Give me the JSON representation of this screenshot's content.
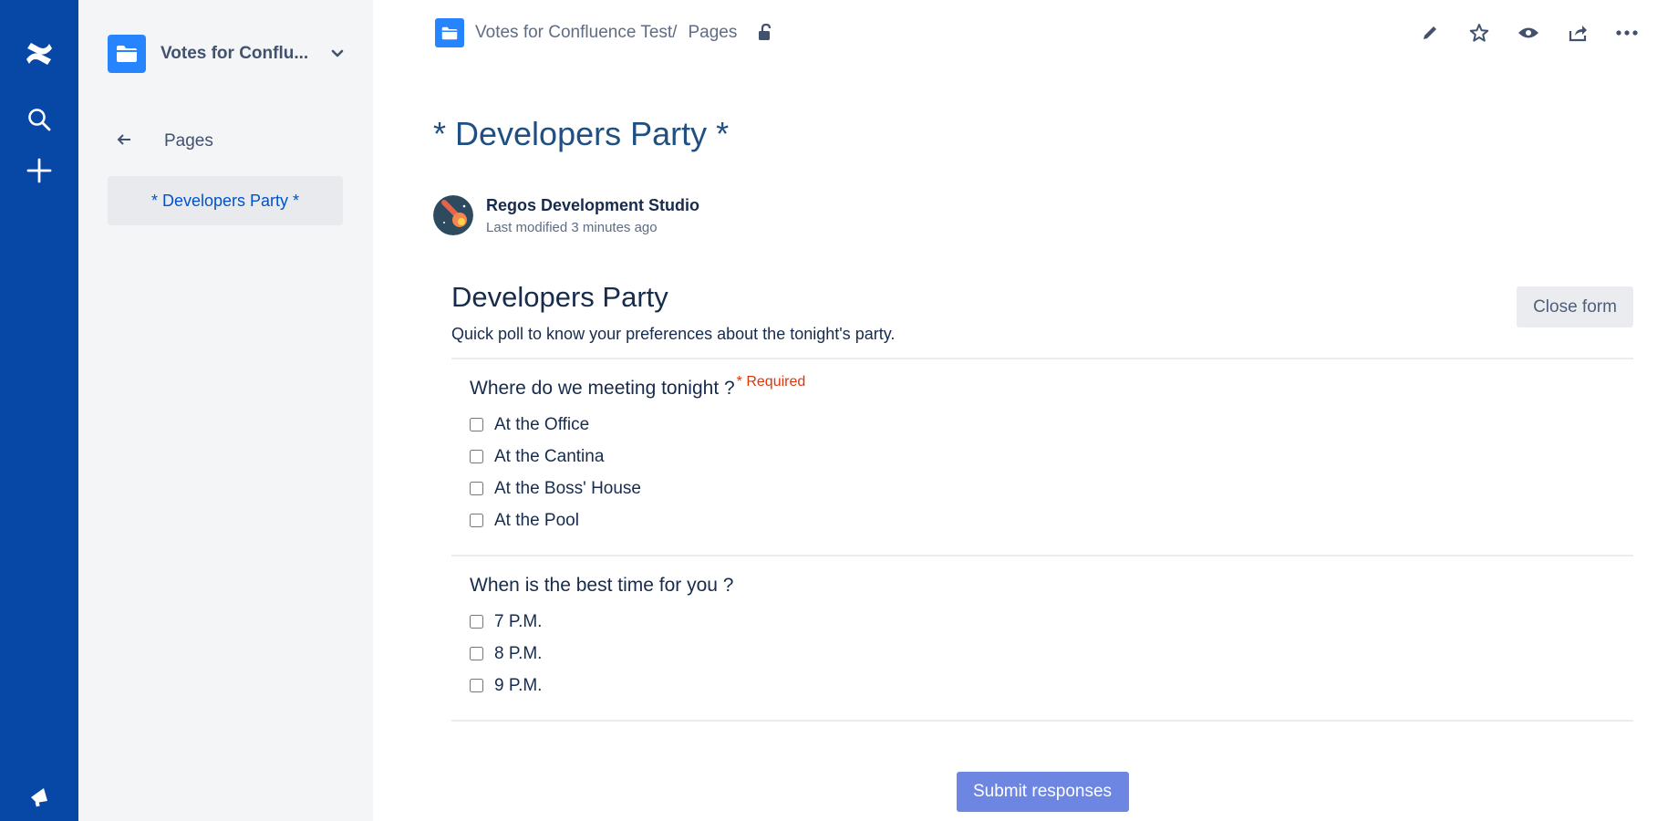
{
  "rail": {
    "logo_icon": "confluence-logo-icon",
    "search_icon": "search-icon",
    "create_icon": "plus-icon",
    "notifications_icon": "megaphone-icon",
    "color": "#0747a6"
  },
  "sidebar": {
    "space_name": "Votes for Conflu...",
    "back_label": "Pages",
    "tree_items": [
      {
        "label": "* Developers Party *"
      }
    ]
  },
  "breadcrumbs": {
    "space": "Votes for Confluence Test/",
    "pages": "Pages"
  },
  "page": {
    "title": "* Developers Party *",
    "author": "Regos Development Studio",
    "modified": "Last modified 3 minutes ago"
  },
  "form": {
    "title": "Developers Party",
    "description": "Quick poll to know your preferences about the tonight's party.",
    "close_label": "Close form",
    "submit_label": "Submit responses",
    "questions": [
      {
        "title": "Where do we meeting tonight ?",
        "required_label": "* Required",
        "options": [
          "At the Office",
          "At the Cantina",
          "At the Boss' House",
          "At the Pool"
        ]
      },
      {
        "title": "When is the best time for you ?",
        "options": [
          "7 P.M.",
          "8 P.M.",
          "9 P.M."
        ]
      }
    ]
  },
  "colors": {
    "primary": "#0052cc",
    "title": "#205081",
    "required": "#de350b",
    "submit": "#6d86e2"
  }
}
